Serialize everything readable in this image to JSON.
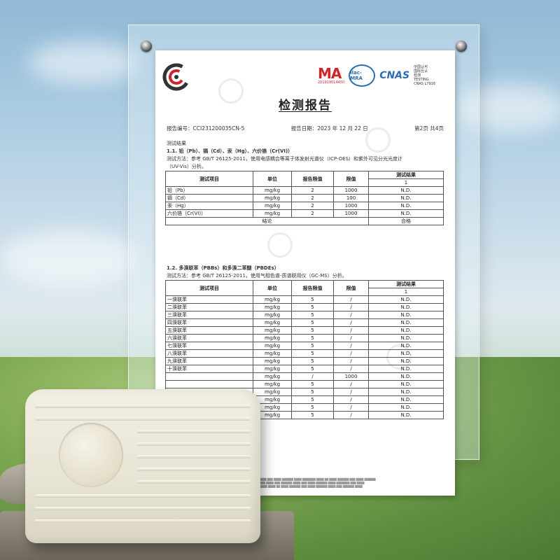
{
  "report": {
    "title": "检测报告",
    "report_no": "报告编号：CCI231200035CN-5",
    "report_date": "报告日期：2023 年 12 月 22 日",
    "page": "第2页  共4页",
    "section_label": "测试结果",
    "s1_title": "1.1. 铅（Pb）、镉（Cd）、汞（Hg）、六价铬（Cr(VI)）",
    "s1_method_1": "测试方法：参考 GB/T 26125-2011，使用电感耦合等离子体发射光谱仪（ICP-OES）和紫外可见分光光度计",
    "s1_method_2": "（UV-Vis）分析。",
    "s1_headers": [
      "测试项目",
      "单位",
      "报告限值",
      "限值",
      "测试结果"
    ],
    "s1_sub": "1",
    "s1_rows": [
      [
        "铅（Pb）",
        "mg/kg",
        "2",
        "1000",
        "N.D."
      ],
      [
        "镉（Cd）",
        "mg/kg",
        "2",
        "100",
        "N.D."
      ],
      [
        "汞（Hg）",
        "mg/kg",
        "2",
        "1000",
        "N.D."
      ],
      [
        "六价铬（Cr(VI)）",
        "mg/kg",
        "2",
        "1000",
        "N.D."
      ]
    ],
    "s1_conclusion": [
      "结论",
      "合格"
    ],
    "s2_title": "1.2. 多溴联苯（PBBs）和多溴二苯醚（PBDEs）",
    "s2_method": "测试方法：参考 GB/T 26125-2011，使用气相色谱-质谱联用仪（GC-MS）分析。",
    "s2_headers": [
      "测试项目",
      "单位",
      "报告限值",
      "限值",
      "测试结果"
    ],
    "s2_sub": "1",
    "s2_rows": [
      [
        "一溴联苯",
        "mg/kg",
        "5",
        "/",
        "N.D."
      ],
      [
        "二溴联苯",
        "mg/kg",
        "5",
        "/",
        "N.D."
      ],
      [
        "三溴联苯",
        "mg/kg",
        "5",
        "/",
        "N.D."
      ],
      [
        "四溴联苯",
        "mg/kg",
        "5",
        "/",
        "N.D."
      ],
      [
        "五溴联苯",
        "mg/kg",
        "5",
        "/",
        "N.D."
      ],
      [
        "六溴联苯",
        "mg/kg",
        "5",
        "/",
        "N.D."
      ],
      [
        "七溴联苯",
        "mg/kg",
        "5",
        "/",
        "N.D."
      ],
      [
        "八溴联苯",
        "mg/kg",
        "5",
        "/",
        "N.D."
      ],
      [
        "九溴联苯",
        "mg/kg",
        "5",
        "/",
        "N.D."
      ],
      [
        "十溴联苯",
        "mg/kg",
        "5",
        "/",
        "N.D."
      ],
      [
        "",
        "mg/kg",
        "/",
        "1000",
        "N.D."
      ],
      [
        "",
        "mg/kg",
        "5",
        "/",
        "N.D."
      ],
      [
        "",
        "mg/kg",
        "5",
        "/",
        "N.D."
      ],
      [
        "",
        "mg/kg",
        "5",
        "/",
        "N.D."
      ],
      [
        "",
        "mg/kg",
        "5",
        "/",
        "N.D."
      ],
      [
        "",
        "mg/kg",
        "5",
        "/",
        "N.D."
      ]
    ]
  },
  "certs": {
    "cma": "MA",
    "cma_num": "201919014450",
    "ilac": "ilac-MRA",
    "cnas": "CNAS",
    "cnas_text": [
      "中国认可",
      "国际互认",
      "检测",
      "TESTING",
      "CNAS L7916"
    ]
  },
  "colors": {
    "sky": "#b9d4e6",
    "grass": "#6f9a47",
    "box": "#ece8d8",
    "cert_blue": "#2a6db5",
    "cma_red": "#d2232a"
  }
}
